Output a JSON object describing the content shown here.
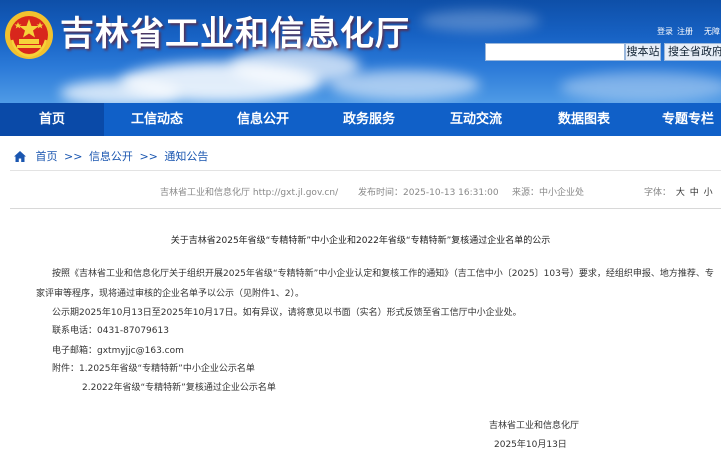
{
  "header": {
    "site_title": "吉林省工业和信息化厅",
    "login": "登录",
    "register": "注册",
    "accessible": "无障",
    "search_site_btn": "搜本站",
    "search_gov_btn": "搜全省政府网"
  },
  "nav": {
    "items": [
      {
        "label": "首页"
      },
      {
        "label": "工信动态"
      },
      {
        "label": "信息公开"
      },
      {
        "label": "政务服务"
      },
      {
        "label": "互动交流"
      },
      {
        "label": "数据图表"
      },
      {
        "label": "专题专栏"
      }
    ]
  },
  "breadcrumb": {
    "home": "首页",
    "sep": ">>",
    "level1": "信息公开",
    "level2": "通知公告"
  },
  "meta": {
    "source_site": "吉林省工业和信息化厅 http://gxt.jl.gov.cn/",
    "publish_time": "发布时间：2025-10-13 16:31:00",
    "from": "来源：中小企业处",
    "font_label": "字体：",
    "font_big": "大",
    "font_mid": "中",
    "font_small": "小"
  },
  "article": {
    "title": "关于吉林省2025年省级“专精特新”中小企业和2022年省级“专精特新”复核通过企业名单的公示",
    "para1_line1": "按照《吉林省工业和信息化厅关于组织开展2025年省级“专精特新”中小企业认定和复核工作的通知》（吉工信中小〔2025〕103号）要求，经组织申报、地方推荐、专",
    "para1_line2": "家评审等程序，现将通过审核的企业名单予以公示（见附件1、2）。",
    "para2": "公示期2025年10月13日至2025年10月17日。如有异议，请将意见以书面（实名）形式反馈至省工信厅中小企业处。",
    "phone": "联系电话：0431-87079613",
    "email": "电子邮箱：gxtmyjjc@163.com",
    "attach1": "附件：1.2025年省级“专精特新”中小企业公示名单",
    "attach2": "2.2022年省级“专精特新”复核通过企业公示名单",
    "sign_org": "吉林省工业和信息化厅",
    "sign_date": "2025年10月13日"
  },
  "colors": {
    "nav_bg": "#1060c8",
    "nav_active": "#0a4aa8",
    "link": "#1a56b0"
  }
}
